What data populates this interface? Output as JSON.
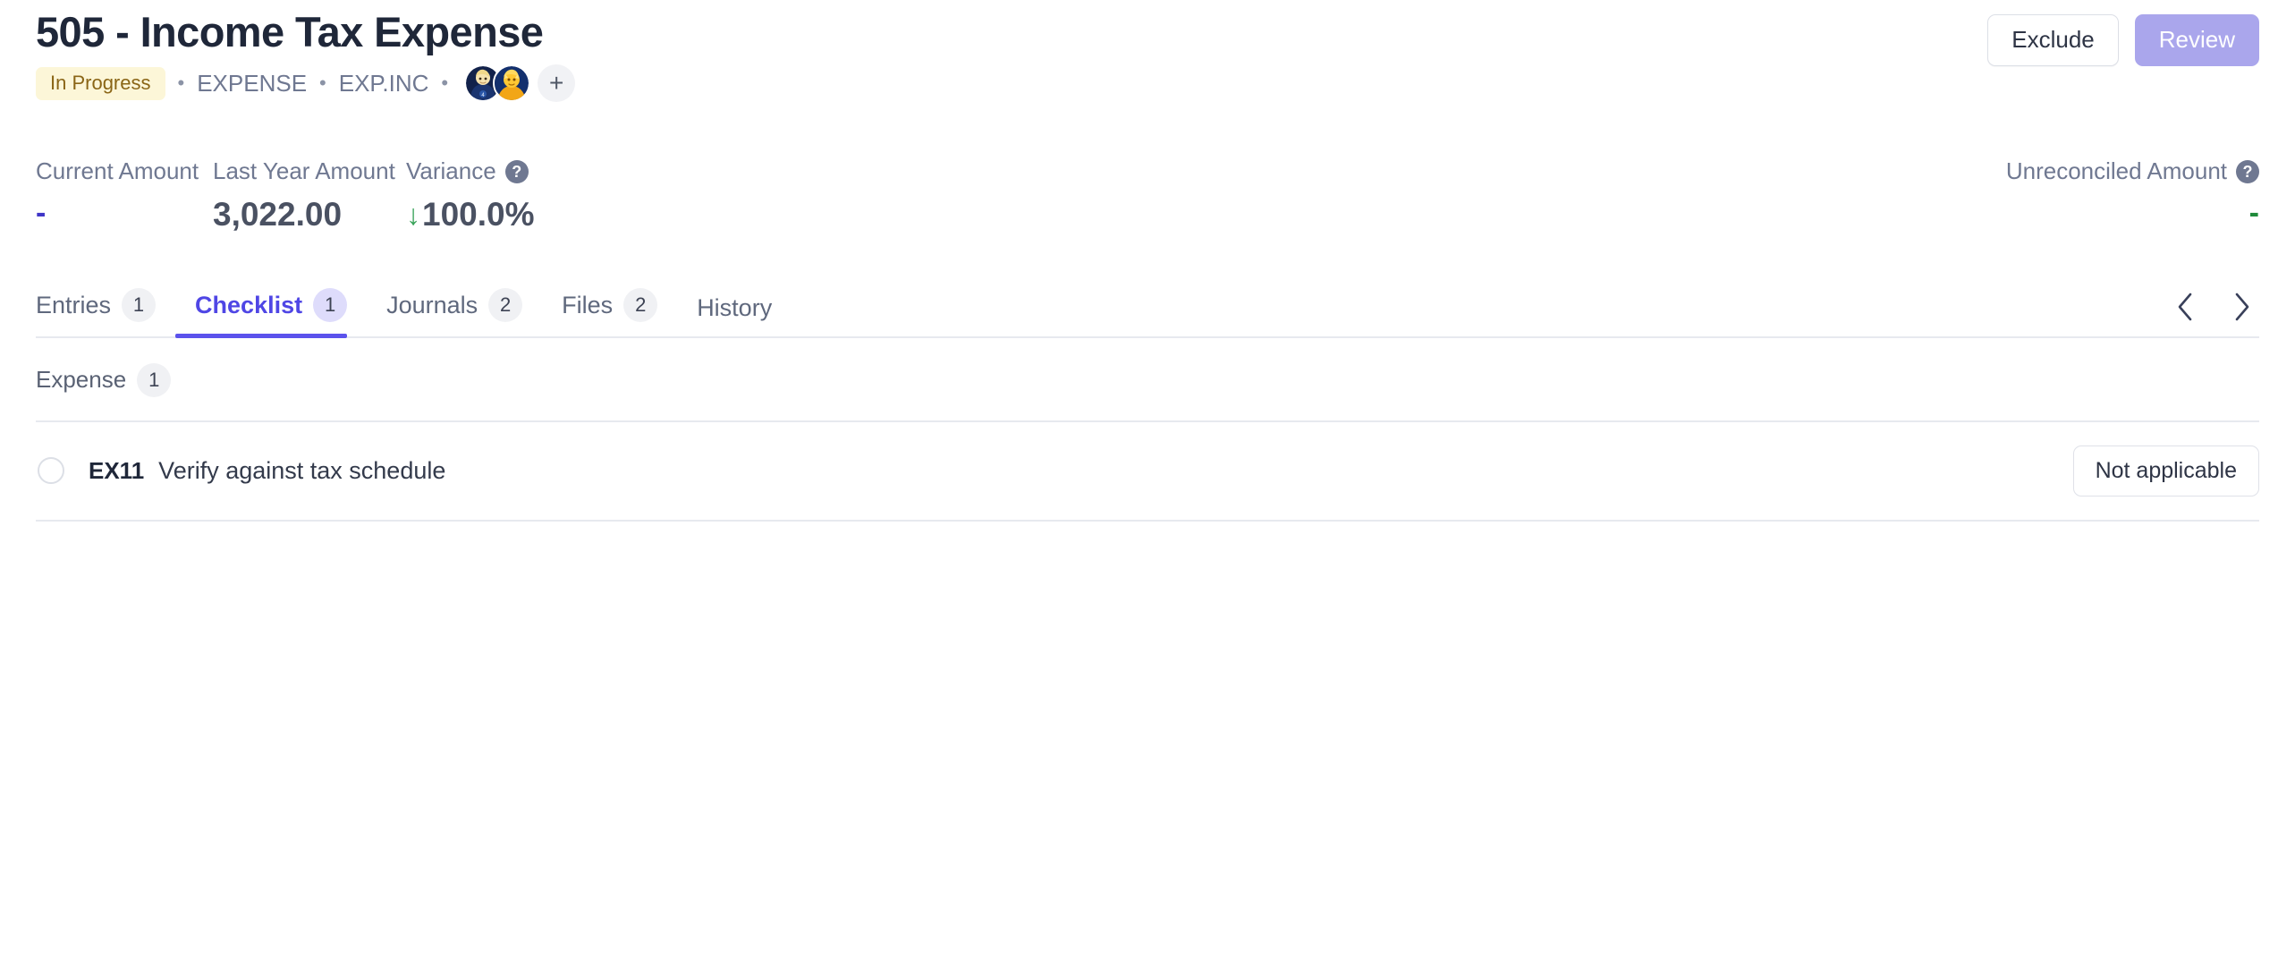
{
  "header": {
    "title": "505 - Income Tax Expense",
    "status_badge": "In Progress",
    "meta": {
      "separator": "•",
      "category": "EXPENSE",
      "code": "EXP.INC"
    },
    "avatars": [
      {
        "name": "assignee-avatar-1",
        "alt": "Assignee 1"
      },
      {
        "name": "assignee-avatar-2",
        "alt": "Assignee 2"
      }
    ],
    "add_assignee_label": "+",
    "actions": {
      "exclude_label": "Exclude",
      "review_label": "Review"
    }
  },
  "kpis": [
    {
      "label": "Current Amount",
      "value": "-",
      "help": false,
      "tone": "indigo"
    },
    {
      "label": "Last Year Amount",
      "value": "3,022.00",
      "help": false,
      "tone": "default"
    },
    {
      "label": "Variance",
      "value": "100.0%",
      "help": true,
      "help_label": "?",
      "tone": "default",
      "trend": "down",
      "trend_glyph": "↓"
    },
    {
      "label": "Unreconciled Amount",
      "value": "-",
      "help": true,
      "help_label": "?",
      "tone": "green"
    }
  ],
  "tabs": [
    {
      "label": "Entries",
      "count": "1",
      "active": false
    },
    {
      "label": "Checklist",
      "count": "1",
      "active": true
    },
    {
      "label": "Journals",
      "count": "2",
      "active": false
    },
    {
      "label": "Files",
      "count": "2",
      "active": false
    },
    {
      "label": "History",
      "count": "",
      "active": false
    }
  ],
  "tab_nav": {
    "prev_icon": "chevron-left-icon",
    "next_icon": "chevron-right-icon"
  },
  "checklist": {
    "group": {
      "label": "Expense",
      "count": "1"
    },
    "items": [
      {
        "code": "EX11",
        "text": "Verify against tax schedule",
        "checked": false,
        "action_label": "Not applicable"
      }
    ]
  },
  "colors": {
    "accent": "#4f46e5",
    "accent_underline": "#5b52ec",
    "primary_button": "#aaa6ec",
    "badge_bg": "#fcf6d8",
    "badge_text": "#8a6516",
    "positive_green": "#3aa35a",
    "indigo_dash": "#3f35c7",
    "green_dash": "#1f8a3b",
    "border": "#e7e9ef"
  }
}
